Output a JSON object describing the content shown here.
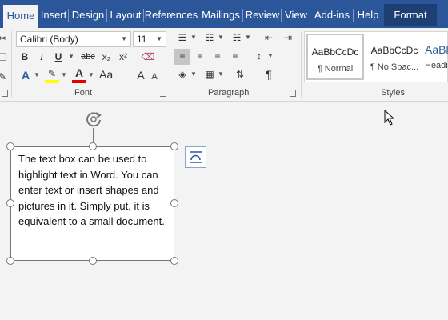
{
  "tabs": [
    {
      "label": "Home",
      "active": true
    },
    {
      "label": "Insert"
    },
    {
      "label": "Design"
    },
    {
      "label": "Layout"
    },
    {
      "label": "References"
    },
    {
      "label": "Mailings"
    },
    {
      "label": "Review"
    },
    {
      "label": "View"
    },
    {
      "label": "Add-ins"
    },
    {
      "label": "Help"
    },
    {
      "label": "Format"
    }
  ],
  "font": {
    "family": "Calibri (Body)",
    "size": "11",
    "group_label": "Font",
    "bold": "B",
    "italic": "I",
    "underline": "U",
    "strike": "abc",
    "sub": "x₂",
    "sup": "x²",
    "grow": "A",
    "shrink": "A"
  },
  "paragraph": {
    "group_label": "Paragraph",
    "pilcrow": "¶"
  },
  "styles": {
    "group_label": "Styles",
    "items": [
      {
        "sample": "AaBbCcDc",
        "name": "¶ Normal"
      },
      {
        "sample": "AaBbCcDc",
        "name": "¶ No Spac..."
      },
      {
        "sample": "AaBl",
        "name": "Headi"
      }
    ]
  },
  "textbox": {
    "text": "The text box can be used to highlight text in Word. You can enter text or insert shapes and pictures in it. Simply put, it is equivalent to a small document."
  },
  "colors": {
    "tab_bar": "#2b579a",
    "format_tab": "#1d3f73",
    "highlight": "#ffff00",
    "font_color": "#e00000"
  },
  "icons": [
    "rotate-handle-icon",
    "layout-options-icon",
    "mouse-pointer-icon"
  ]
}
